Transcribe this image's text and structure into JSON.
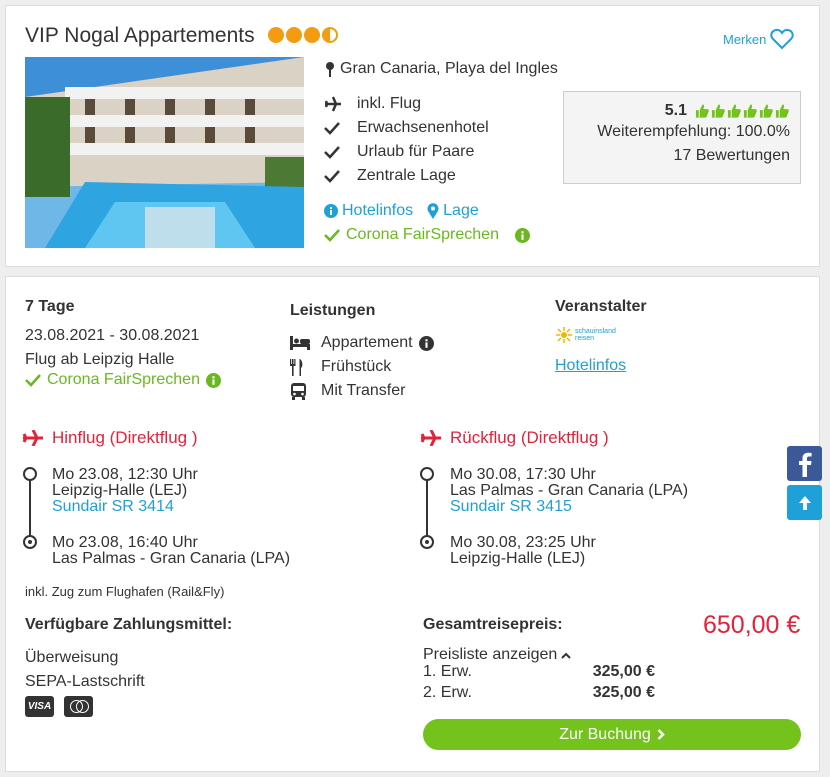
{
  "hotel": {
    "name": "VIP Nogal Appartements",
    "stars": 3.5,
    "merken_label": "Merken",
    "location": "Gran Canaria, Playa del Ingles",
    "features": [
      "inkl. Flug",
      "Erwachsenenhotel",
      "Urlaub für Paare",
      "Zentrale Lage"
    ],
    "links": {
      "hotelinfos": "Hotelinfos",
      "lage": "Lage"
    },
    "corona": "Corona FairSprechen",
    "rating": {
      "score": "5.1",
      "score_value": 5.1,
      "score_max": 6,
      "recommendation": "Weiterempfehlung: 100.0%",
      "reviews": "17 Bewertungen"
    }
  },
  "offer": {
    "duration": "7 Tage",
    "dates": "23.08.2021 - 30.08.2021",
    "departure": "Flug ab Leipzig Halle",
    "corona": "Corona FairSprechen",
    "services_heading": "Leistungen",
    "services": [
      "Appartement",
      "Frühstück",
      "Mit Transfer"
    ],
    "operator_heading": "Veranstalter",
    "operator_logo_text": [
      "schauinsland",
      "reisen"
    ],
    "operator_link": "Hotelinfos"
  },
  "flights": {
    "outbound": {
      "title": "Hinflug (Direktflug )",
      "dep_time": "Mo 23.08, 12:30 Uhr",
      "dep_airport": "Leipzig-Halle (LEJ)",
      "carrier": "Sundair SR 3414",
      "arr_time": "Mo 23.08, 16:40 Uhr",
      "arr_airport": "Las Palmas - Gran Canaria (LPA)"
    },
    "return": {
      "title": "Rückflug (Direktflug )",
      "dep_time": "Mo 30.08, 17:30 Uhr",
      "dep_airport": "Las Palmas - Gran Canaria (LPA)",
      "carrier": "Sundair SR 3415",
      "arr_time": "Mo 30.08, 23:25 Uhr",
      "arr_airport": "Leipzig-Halle (LEJ)"
    },
    "rail_note": "inkl. Zug zum Flughafen (Rail&Fly)"
  },
  "payment": {
    "heading": "Verfügbare Zahlungsmittel:",
    "methods": [
      "Überweisung",
      "SEPA-Lastschrift"
    ],
    "card_icons": [
      "VISA",
      "mastercard"
    ]
  },
  "price": {
    "label": "Gesamtreisepreis:",
    "total": "650,00 €",
    "pricelist_toggle": "Preisliste anzeigen",
    "rows": [
      {
        "label": "1. Erw.",
        "amount": "325,00 €"
      },
      {
        "label": "2. Erw.",
        "amount": "325,00 €"
      }
    ],
    "book_button": "Zur Buchung"
  },
  "colors": {
    "accent_blue": "#1ea0d8",
    "star_orange": "#f39c12",
    "green": "#74c21c",
    "red": "#e3223a",
    "facebook": "#3b5998"
  }
}
